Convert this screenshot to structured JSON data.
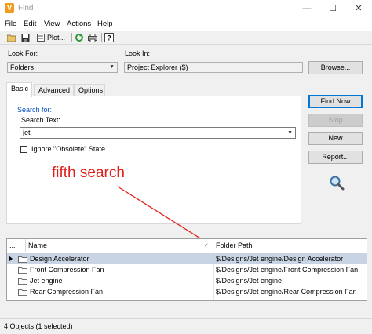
{
  "window": {
    "title": "Find",
    "app_icon": "V"
  },
  "window_controls": {
    "minimize": "—",
    "maximize": "☐",
    "close": "✕"
  },
  "menu": {
    "items": [
      {
        "label": "File"
      },
      {
        "label": "Edit"
      },
      {
        "label": "View"
      },
      {
        "label": "Actions"
      },
      {
        "label": "Help"
      }
    ]
  },
  "toolbar": {
    "plot_label": "Plot...",
    "icons": [
      "open-folder-icon",
      "save-icon",
      "print-preview-icon",
      "refresh-icon",
      "print-icon",
      "help-icon"
    ]
  },
  "search": {
    "look_for_label": "Look For:",
    "look_for_value": "Folders",
    "look_in_label": "Look In:",
    "look_in_value": "Project Explorer ($)",
    "browse_label": "Browse..."
  },
  "tabs": [
    {
      "label": "Basic"
    },
    {
      "label": "Advanced"
    },
    {
      "label": "Options"
    }
  ],
  "basic_tab": {
    "search_for_label": "Search for:",
    "search_text_label": "Search Text:",
    "search_text_value": "jet",
    "ignore_obsolete_label": "Ignore \"Obsolete\" State"
  },
  "actions": {
    "find_now": "Find Now",
    "stop": "Stop",
    "new": "New",
    "report": "Report..."
  },
  "annotation": {
    "text": "fifth search",
    "color": "#e0201a"
  },
  "results": {
    "columns": [
      "...",
      "Name",
      "Folder Path"
    ],
    "rows": [
      {
        "name": "Design Accelerator",
        "path": "$/Designs/Jet engine/Design Accelerator",
        "selected": true
      },
      {
        "name": "Front Compression Fan",
        "path": "$/Designs/Jet engine/Front Compression Fan",
        "selected": false
      },
      {
        "name": "Jet engine",
        "path": "$/Designs/Jet engine",
        "selected": false
      },
      {
        "name": "Rear Compression Fan",
        "path": "$/Designs/Jet engine/Rear Compression Fan",
        "selected": false
      }
    ]
  },
  "status": {
    "text": "4 Objects (1 selected)"
  },
  "colors": {
    "accent": "#0078d7",
    "selection": "#c8d4e3",
    "annotation": "#e0201a",
    "app_icon": "#f29c1f"
  }
}
